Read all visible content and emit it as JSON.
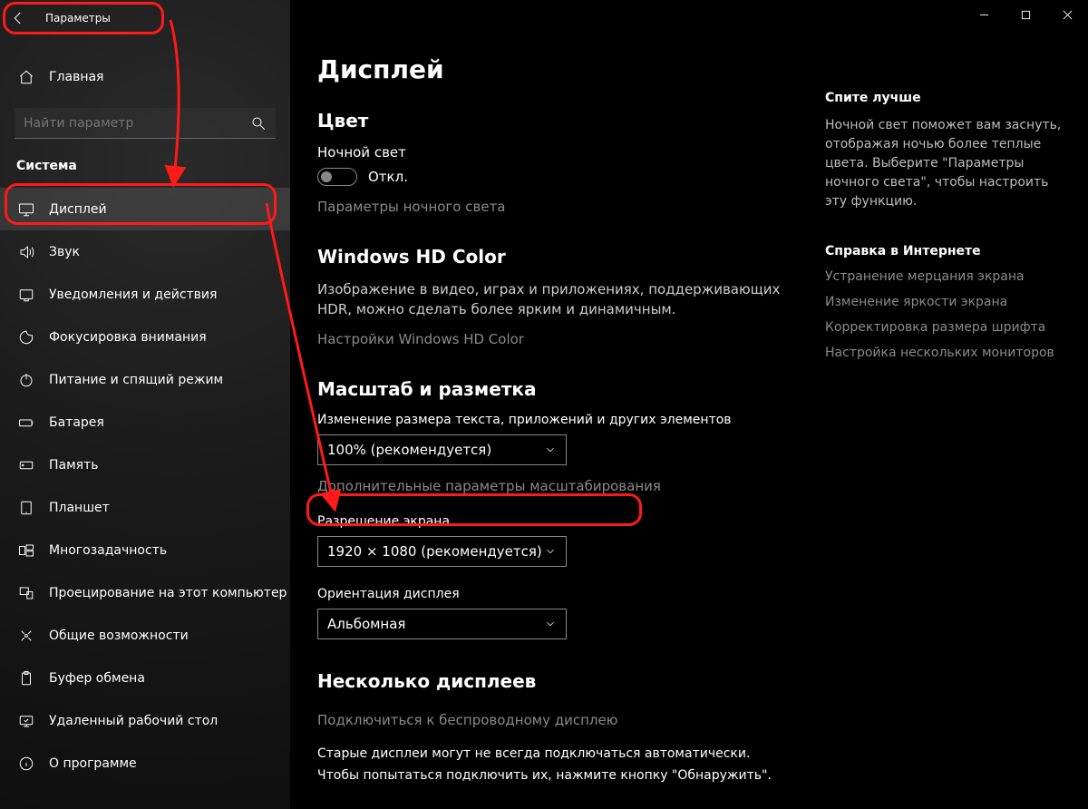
{
  "titlebar": {
    "title": "Параметры"
  },
  "sidebar": {
    "home": "Главная",
    "search_placeholder": "Найти параметр",
    "section": "Система",
    "items": [
      {
        "name": "display",
        "label": "Дисплей",
        "selected": true
      },
      {
        "name": "sound",
        "label": "Звук"
      },
      {
        "name": "notif",
        "label": "Уведомления и действия"
      },
      {
        "name": "focus",
        "label": "Фокусировка внимания"
      },
      {
        "name": "power",
        "label": "Питание и спящий режим"
      },
      {
        "name": "battery",
        "label": "Батарея"
      },
      {
        "name": "storage",
        "label": "Память"
      },
      {
        "name": "tablet",
        "label": "Планшет"
      },
      {
        "name": "multitask",
        "label": "Многозадачность"
      },
      {
        "name": "project",
        "label": "Проецирование на этот компьютер"
      },
      {
        "name": "shared",
        "label": "Общие возможности"
      },
      {
        "name": "clipboard",
        "label": "Буфер обмена"
      },
      {
        "name": "remote",
        "label": "Удаленный рабочий стол"
      },
      {
        "name": "about",
        "label": "О программе"
      }
    ]
  },
  "main": {
    "title": "Дисплей",
    "color": {
      "heading": "Цвет",
      "night_label": "Ночной свет",
      "night_state": "Откл.",
      "night_link": "Параметры ночного света"
    },
    "hdcolor": {
      "heading": "Windows HD Color",
      "desc": "Изображение в видео, играх и приложениях, поддерживающих HDR, можно сделать более ярким и динамичным.",
      "link": "Настройки Windows HD Color"
    },
    "scale": {
      "heading": "Масштаб и разметка",
      "size_label": "Изменение размера текста, приложений и других элементов",
      "size_value": "100% (рекомендуется)",
      "adv_link": "Дополнительные параметры масштабирования",
      "res_label": "Разрешение экрана",
      "res_value": "1920 × 1080 (рекомендуется)",
      "orient_label": "Ориентация дисплея",
      "orient_value": "Альбомная"
    },
    "multi": {
      "heading": "Несколько дисплеев",
      "wireless_link": "Подключиться к беспроводному дисплею",
      "desc1": "Старые дисплеи могут не всегда подключаться автоматически.",
      "desc2": "Чтобы попытаться подключить их, нажмите кнопку \"Обнаружить\"."
    }
  },
  "right": {
    "sleep_head": "Спите лучше",
    "sleep_desc": "Ночной свет поможет вам заснуть, отображая ночью более теплые цвета. Выберите \"Параметры ночного света\", чтобы настроить эту функцию.",
    "help_head": "Справка в Интернете",
    "links": [
      "Устранение мерцания экрана",
      "Изменение яркости экрана",
      "Корректировка размера шрифта",
      "Настройка нескольких мониторов"
    ]
  }
}
